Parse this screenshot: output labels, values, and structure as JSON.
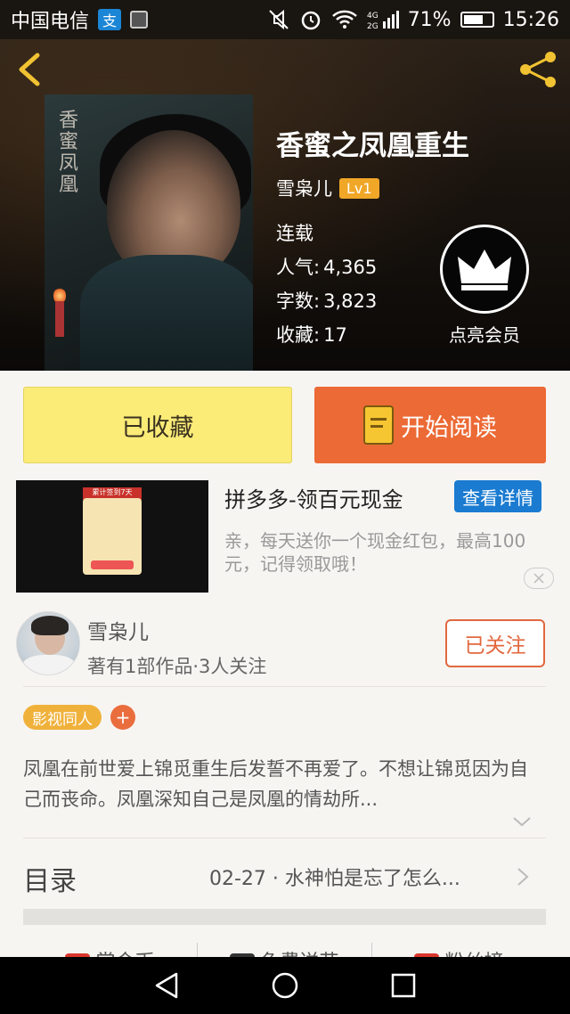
{
  "status_bar": {
    "carrier": "中国电信",
    "alipay_icon_text": "支",
    "battery": "71%",
    "battery_level": 0.71,
    "network": "4G 2G",
    "time": "15:26"
  },
  "book": {
    "title": "香蜜之凤凰重生",
    "author": "雪枭儿",
    "level": "Lv1",
    "status": "连载",
    "popularity_label": "人气:",
    "popularity": "4,365",
    "words_label": "字数:",
    "words": "3,823",
    "favorites_label": "收藏:",
    "favorites": "17",
    "cover_calligraphy": "香蜜 凤凰"
  },
  "vip": {
    "label": "点亮会员"
  },
  "actions": {
    "collected_label": "已收藏",
    "read_label": "开始阅读"
  },
  "ad": {
    "title": "拼多多-领百元现金",
    "detail_label": "查看详情",
    "description": "亲，每天送你一个现金红包，最高100元，记得领取哦！",
    "thumb_text": "累计签到7天"
  },
  "author_card": {
    "name": "雪枭儿",
    "meta": "著有1部作品·3人关注",
    "follow_label": "已关注"
  },
  "tags": [
    {
      "label": "影视同人"
    }
  ],
  "tag_add": "+",
  "synopsis": "凤凰在前世爱上锦觅重生后发誓不再爱了。不想让锦觅因为自己而丧命。凤凰深知自己是凤凰的情劫所...",
  "catalog": {
    "label": "目录",
    "latest": "02-27 · 水神怕是忘了怎么..."
  },
  "bottom_tabs": [
    {
      "label": "赏金币",
      "color": "#d9362b"
    },
    {
      "label": "免费送花",
      "color": "#333333"
    },
    {
      "label": "粉丝榜",
      "color": "#d9362b"
    }
  ],
  "colors": {
    "accent_orange": "#ec6a35",
    "collect_yellow": "#fbeb77",
    "ad_blue": "#1a7bd1",
    "level_badge": "#f0a728"
  }
}
